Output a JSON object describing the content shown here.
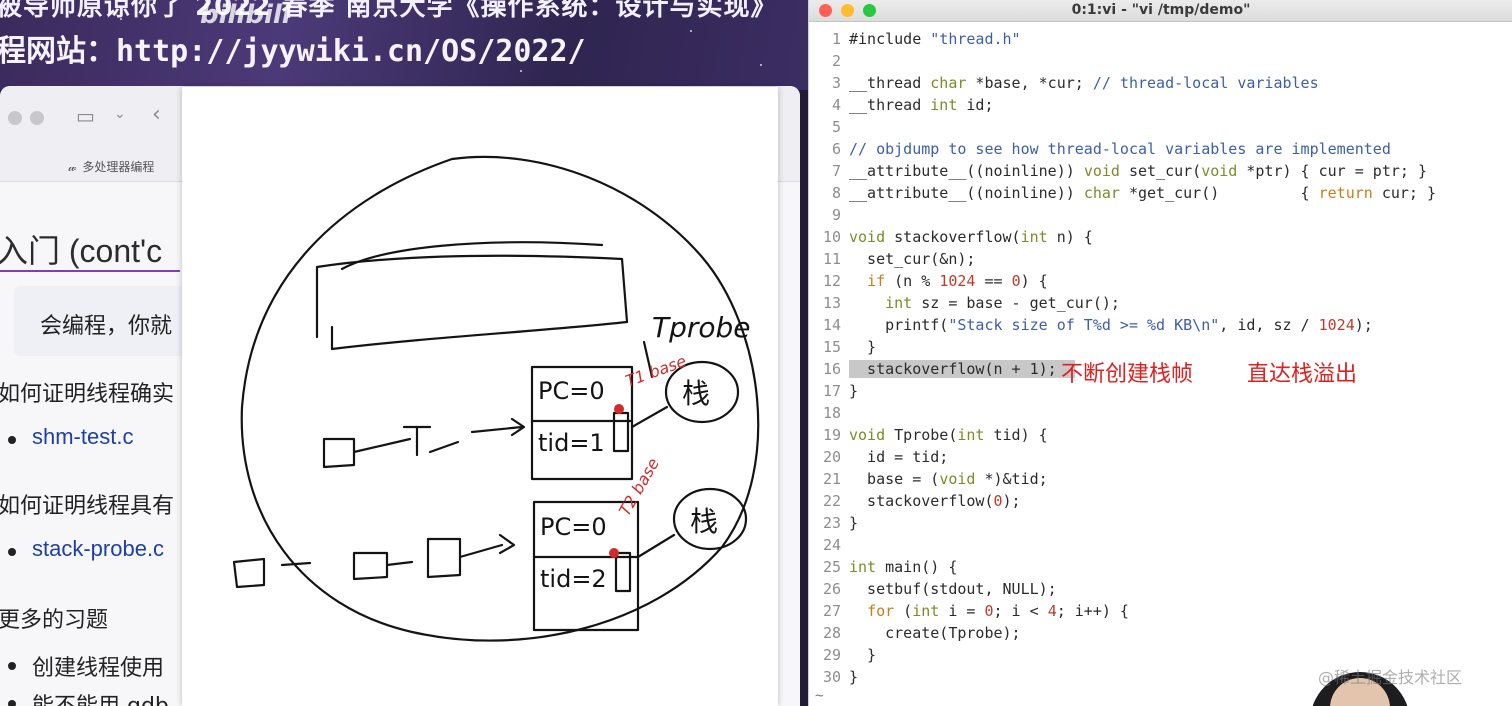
{
  "banner": {
    "line1": "被导师原谅你了  2022 春季 南京大学《操作系统：设计与实现》",
    "line2": "程网站：http://jyywiki.cn/OS/2022/",
    "mark": "bilibili"
  },
  "slide": {
    "tab_label": "多处理器编程",
    "heading": "入门 (cont'c",
    "quote": "会编程，你就",
    "q1": "如何证明线程确实",
    "link1": "shm-test.c",
    "q2": "如何证明线程具有",
    "link2": "stack-probe.c",
    "q3": "更多的习题",
    "b3": "创建线程使用",
    "b4": "能不能用 gdb"
  },
  "whiteboard": {
    "label_tprobe": "Tprobe",
    "pc1": "PC=0",
    "tid1": "tid=1",
    "pc2": "PC=0",
    "tid2": "tid=2",
    "stack1": "栈",
    "stack2": "栈",
    "base1": "T1 base",
    "base2": "T2 base",
    "row1": "口—a—b—c",
    "row2": "口…口→a—b"
  },
  "terminal": {
    "title": "0:1:vi - \"vi /tmp/demo\"",
    "tilde": "~",
    "lines": [
      [
        [
          "tk-plain",
          "#include "
        ],
        [
          "tk-str",
          "\"thread.h\""
        ]
      ],
      [],
      [
        [
          "tk-plain",
          "__thread "
        ],
        [
          "tk-type",
          "char"
        ],
        [
          "tk-plain",
          " *base, *cur; "
        ],
        [
          "tk-cmt",
          "// thread-local variables"
        ]
      ],
      [
        [
          "tk-plain",
          "__thread "
        ],
        [
          "tk-type",
          "int"
        ],
        [
          "tk-plain",
          " id;"
        ]
      ],
      [],
      [
        [
          "tk-cmt",
          "// objdump to see how thread-local variables are implemented"
        ]
      ],
      [
        [
          "tk-plain",
          "__attribute__((noinline)) "
        ],
        [
          "tk-type",
          "void"
        ],
        [
          "tk-plain",
          " set_cur("
        ],
        [
          "tk-type",
          "void"
        ],
        [
          "tk-plain",
          " *ptr) { cur = ptr; }"
        ]
      ],
      [
        [
          "tk-plain",
          "__attribute__((noinline)) "
        ],
        [
          "tk-type",
          "char"
        ],
        [
          "tk-plain",
          " *get_cur()         { "
        ],
        [
          "tk-kw",
          "return"
        ],
        [
          "tk-plain",
          " cur; }"
        ]
      ],
      [],
      [
        [
          "tk-type",
          "void"
        ],
        [
          "tk-plain",
          " stackoverflow("
        ],
        [
          "tk-type",
          "int"
        ],
        [
          "tk-plain",
          " n) {"
        ]
      ],
      [
        [
          "tk-plain",
          "  set_cur(&n);"
        ]
      ],
      [
        [
          "tk-plain",
          "  "
        ],
        [
          "tk-kw",
          "if"
        ],
        [
          "tk-plain",
          " (n % "
        ],
        [
          "tk-num",
          "1024"
        ],
        [
          "tk-plain",
          " == "
        ],
        [
          "tk-num",
          "0"
        ],
        [
          "tk-plain",
          ") {"
        ]
      ],
      [
        [
          "tk-plain",
          "    "
        ],
        [
          "tk-type",
          "int"
        ],
        [
          "tk-plain",
          " sz = base - get_cur();"
        ]
      ],
      [
        [
          "tk-plain",
          "    printf("
        ],
        [
          "tk-str",
          "\"Stack size of T%d >= %d KB\\n\""
        ],
        [
          "tk-plain",
          ", id, sz / "
        ],
        [
          "tk-num",
          "1024"
        ],
        [
          "tk-plain",
          ");"
        ]
      ],
      [
        [
          "tk-plain",
          "  }"
        ]
      ],
      [
        [
          "tk-sel",
          "  stackoverflow(n + "
        ],
        [
          "tk-sel",
          "1"
        ],
        [
          "tk-sel",
          ");  "
        ]
      ],
      [
        [
          "tk-plain",
          "}"
        ]
      ],
      [],
      [
        [
          "tk-type",
          "void"
        ],
        [
          "tk-plain",
          " Tprobe("
        ],
        [
          "tk-type",
          "int"
        ],
        [
          "tk-plain",
          " tid) {"
        ]
      ],
      [
        [
          "tk-plain",
          "  id = tid;"
        ]
      ],
      [
        [
          "tk-plain",
          "  base = ("
        ],
        [
          "tk-type",
          "void"
        ],
        [
          "tk-plain",
          " *)&tid;"
        ]
      ],
      [
        [
          "tk-plain",
          "  stackoverflow("
        ],
        [
          "tk-num",
          "0"
        ],
        [
          "tk-plain",
          ");"
        ]
      ],
      [
        [
          "tk-plain",
          "}"
        ]
      ],
      [],
      [
        [
          "tk-type",
          "int"
        ],
        [
          "tk-plain",
          " main() {"
        ]
      ],
      [
        [
          "tk-plain",
          "  setbuf(stdout, NULL);"
        ]
      ],
      [
        [
          "tk-plain",
          "  "
        ],
        [
          "tk-kw",
          "for"
        ],
        [
          "tk-plain",
          " ("
        ],
        [
          "tk-type",
          "int"
        ],
        [
          "tk-plain",
          " i = "
        ],
        [
          "tk-num",
          "0"
        ],
        [
          "tk-plain",
          "; i < "
        ],
        [
          "tk-num",
          "4"
        ],
        [
          "tk-plain",
          "; i++) {"
        ]
      ],
      [
        [
          "tk-plain",
          "    create(Tprobe);"
        ]
      ],
      [
        [
          "tk-plain",
          "  }"
        ]
      ],
      [
        [
          "tk-plain",
          "}"
        ]
      ]
    ],
    "annotation_a": "不断创建栈帧",
    "annotation_b": "直达栈溢出"
  },
  "watermark": "@稀土掘金技术社区",
  "colors": {
    "accent_purple": "#7b3fb6",
    "link_blue": "#1f3fa8",
    "annotation_red": "#e02020",
    "keyword": "#c47f1b",
    "type": "#7d8b2a",
    "comment": "#3d5fa8"
  }
}
